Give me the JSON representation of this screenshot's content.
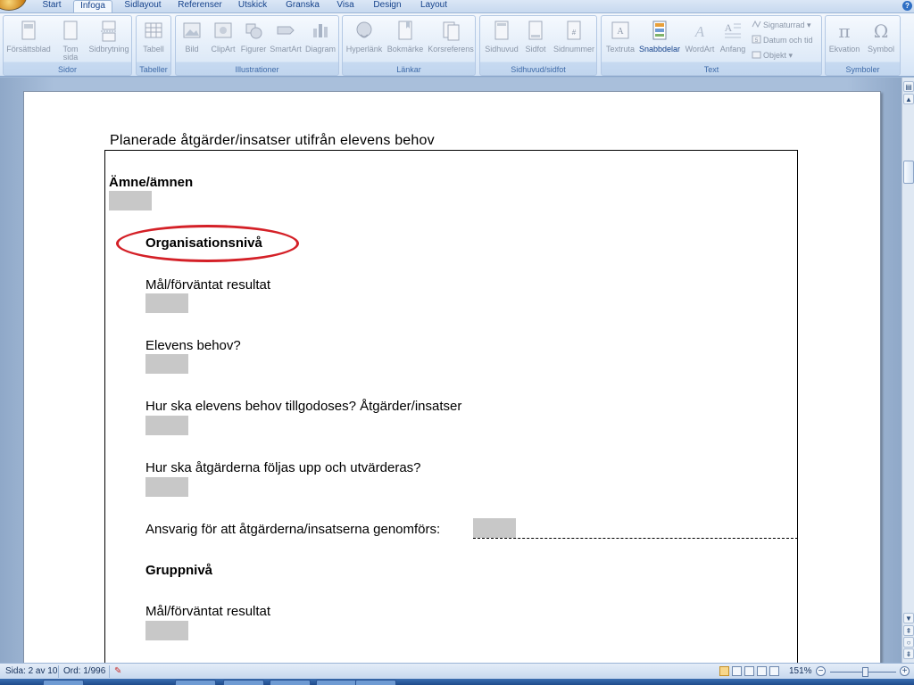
{
  "tabs": [
    {
      "label": "Start"
    },
    {
      "label": "Infoga",
      "active": true
    },
    {
      "label": "Sidlayout"
    },
    {
      "label": "Referenser"
    },
    {
      "label": "Utskick"
    },
    {
      "label": "Granska"
    },
    {
      "label": "Visa"
    },
    {
      "label": "Design"
    },
    {
      "label": "Layout"
    }
  ],
  "ribbon": {
    "groups": {
      "sidor": {
        "label": "Sidor",
        "buttons": [
          "Försättsblad",
          "Tom sida",
          "Sidbrytning"
        ]
      },
      "tabeller": {
        "label": "Tabeller",
        "buttons": [
          "Tabell"
        ]
      },
      "illustrationer": {
        "label": "Illustrationer",
        "buttons": [
          "Bild",
          "ClipArt",
          "Figurer",
          "SmartArt",
          "Diagram"
        ]
      },
      "lankar": {
        "label": "Länkar",
        "buttons": [
          "Hyperlänk",
          "Bokmärke",
          "Korsreferens"
        ]
      },
      "sidhuvud": {
        "label": "Sidhuvud/sidfot",
        "buttons": [
          "Sidhuvud",
          "Sidfot",
          "Sidnummer"
        ]
      },
      "text": {
        "label": "Text",
        "buttons": [
          "Textruta",
          "Snabbdelar",
          "WordArt",
          "Anfang"
        ],
        "small": [
          "Signaturrad",
          "Datum och tid",
          "Objekt"
        ]
      },
      "symboler": {
        "label": "Symboler",
        "buttons": [
          "Ekvation",
          "Symbol"
        ]
      }
    }
  },
  "document": {
    "heading": "Planerade åtgärder/insatser utifrån elevens behov",
    "subject_label": "Ämne/ämnen",
    "sections": [
      {
        "title": "Organisationsnivå",
        "items": [
          "Mål/förväntat resultat",
          "Elevens behov?",
          "Hur ska elevens behov tillgodoses? Åtgärder/insatser",
          "Hur ska åtgärderna följas upp och utvärderas?"
        ],
        "responsible": "Ansvarig för att åtgärderna/insatserna genomförs:"
      },
      {
        "title": "Gruppnivå",
        "items": [
          "Mål/förväntat resultat"
        ]
      }
    ]
  },
  "statusbar": {
    "page": "Sida: 2 av 10",
    "words": "Ord: 1/996",
    "zoom": "151%"
  },
  "colors": {
    "highlight": "#d42027",
    "form_field": "#c8c8c8",
    "ribbon_label": "#3e6aa8"
  }
}
